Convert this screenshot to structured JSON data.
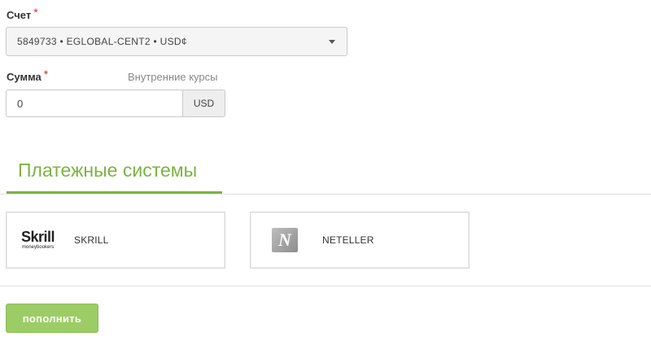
{
  "account": {
    "label": "Счет",
    "required_mark": "*",
    "selected_value": "5849733 • EGLOBAL-CENT2 • USD¢"
  },
  "amount": {
    "label": "Сумма",
    "required_mark": "*",
    "rates_link": "Внутренние курсы",
    "value": "0",
    "currency": "USD"
  },
  "payment": {
    "tab_label": "Платежные системы",
    "methods": [
      {
        "name": "SKRILL",
        "logo_text": "Skrill",
        "logo_subtext": "moneybookers",
        "icon": "skrill-logo"
      },
      {
        "name": "NETELLER",
        "logo_text": "N",
        "icon": "neteller-logo"
      }
    ]
  },
  "actions": {
    "submit_label": "пополнить"
  },
  "colors": {
    "accent": "#7cb342",
    "button": "#9ccc65",
    "required": "#c0392b"
  }
}
